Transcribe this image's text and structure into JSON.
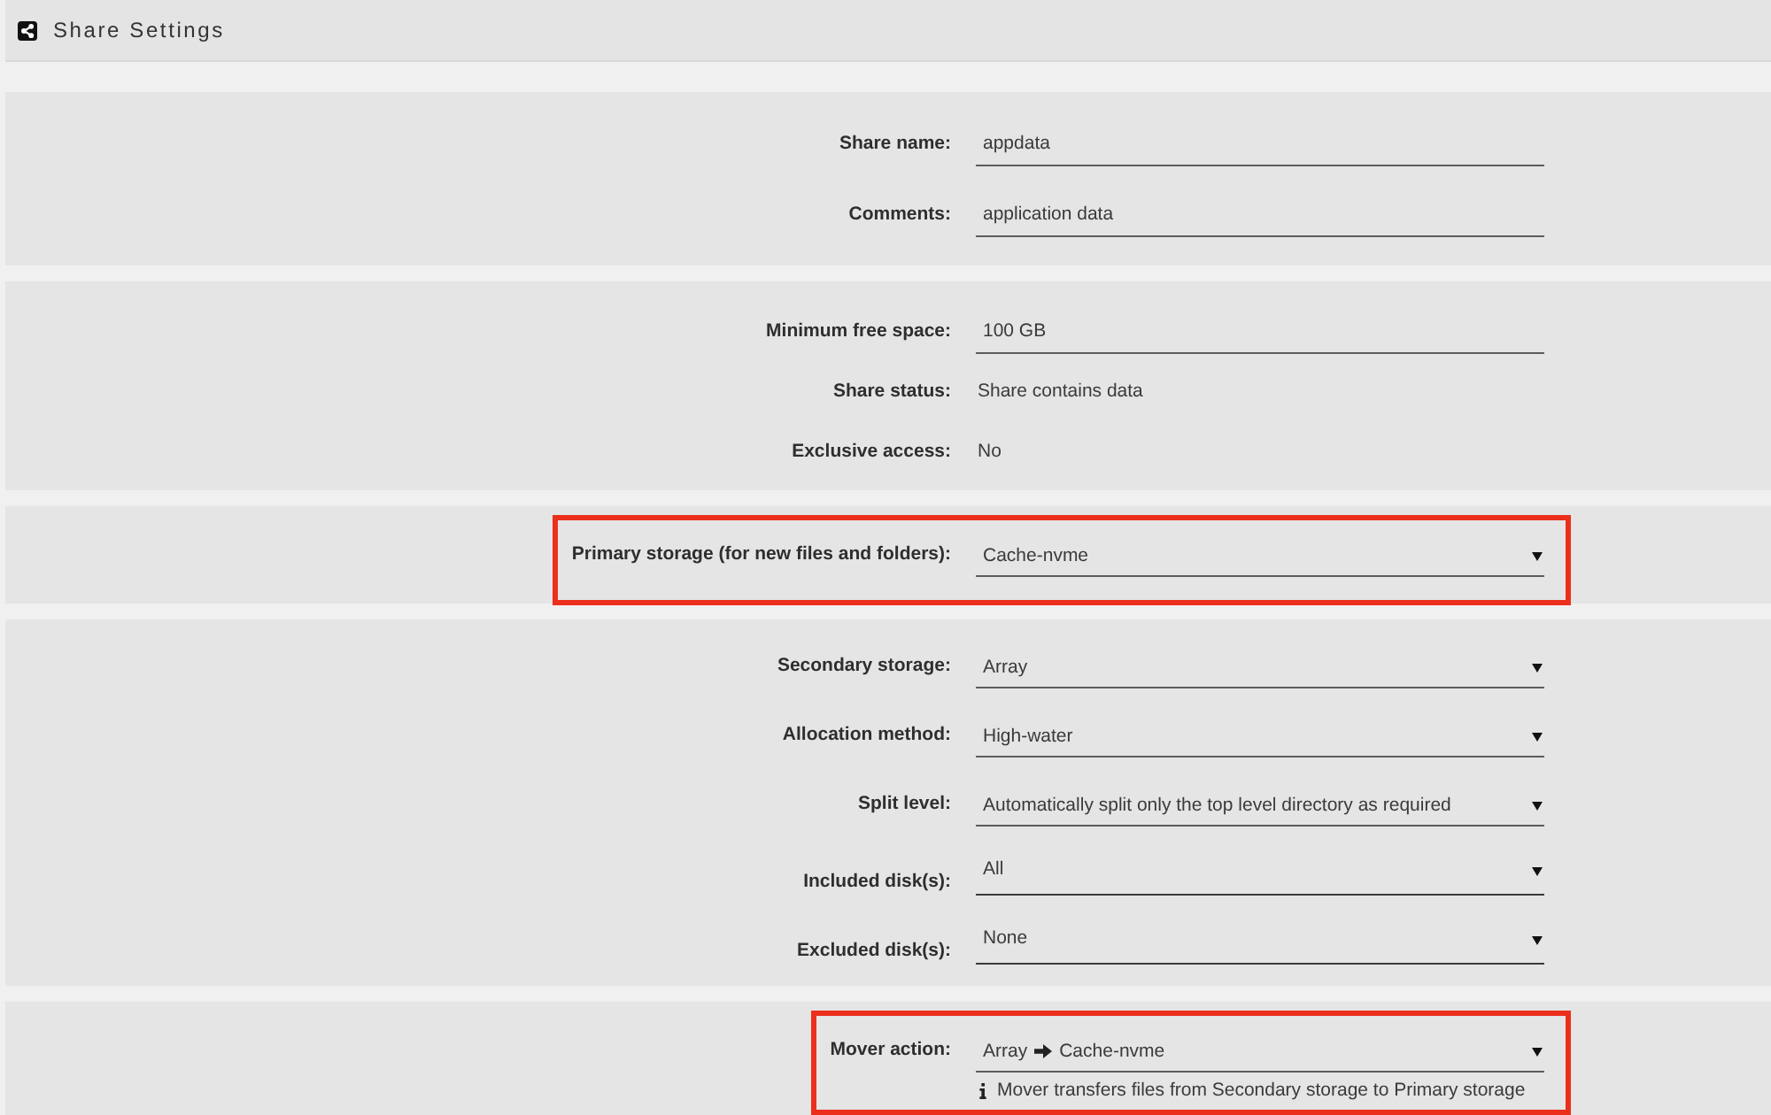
{
  "header": {
    "title": "Share Settings"
  },
  "sections": [
    {
      "rows": [
        {
          "kind": "input",
          "label": "Share name:",
          "value": "appdata",
          "highlighted": false
        },
        {
          "kind": "input",
          "label": "Comments:",
          "value": "application data",
          "highlighted": false
        }
      ]
    },
    {
      "rows": [
        {
          "kind": "input",
          "label": "Minimum free space:",
          "value": "100 GB",
          "highlighted": false
        },
        {
          "kind": "text",
          "label": "Share status:",
          "value": "Share contains data",
          "highlighted": false
        },
        {
          "kind": "text",
          "label": "Exclusive access:",
          "value": "No",
          "highlighted": false
        }
      ]
    },
    {
      "rows": [
        {
          "kind": "select",
          "label": "Primary storage (for new files and folders):",
          "value": "Cache-nvme",
          "highlighted": true
        }
      ]
    },
    {
      "rows": [
        {
          "kind": "select",
          "label": "Secondary storage:",
          "value": "Array",
          "highlighted": false
        },
        {
          "kind": "select",
          "label": "Allocation method:",
          "value": "High-water",
          "highlighted": false
        },
        {
          "kind": "select",
          "label": "Split level:",
          "value": "Automatically split only the top level directory as required",
          "highlighted": false
        },
        {
          "kind": "multiselect",
          "label": "Included disk(s):",
          "value": "All",
          "highlighted": false
        },
        {
          "kind": "multiselect",
          "label": "Excluded disk(s):",
          "value": "None",
          "highlighted": false
        }
      ]
    },
    {
      "rows": [
        {
          "kind": "mover",
          "label": "Mover action:",
          "source": "Array",
          "target": "Cache-nvme",
          "note": "Mover transfers files from Secondary storage to Primary storage",
          "highlighted": true
        }
      ]
    }
  ]
}
